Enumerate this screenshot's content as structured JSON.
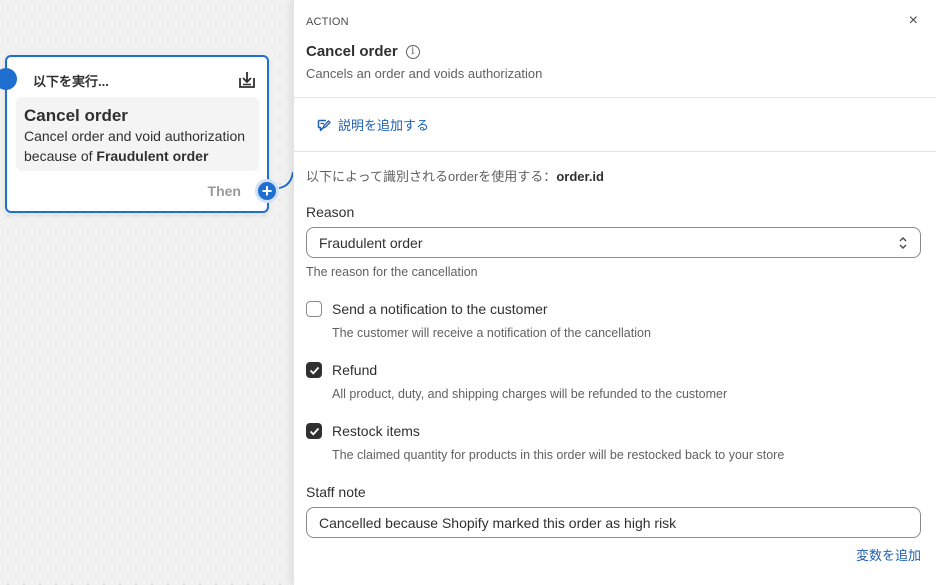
{
  "node": {
    "header_label": "以下を実行...",
    "title": "Cancel order",
    "desc_prefix": "Cancel order and void authorization because of ",
    "desc_reason": "Fraudulent order",
    "then_label": "Then",
    "plus": "+"
  },
  "panel": {
    "kicker": "ACTION",
    "close": "×",
    "title": "Cancel order",
    "info": "i",
    "subtitle": "Cancels an order and voids authorization",
    "add_description": "説明を追加する",
    "using_prefix": "以下によって識別されるorderを使用する：",
    "using_value": "order.id",
    "reason": {
      "label": "Reason",
      "value": "Fraudulent order",
      "help": "The reason for the cancellation"
    },
    "options": [
      {
        "label": "Send a notification to the customer",
        "help": "The customer will receive a notification of the cancellation",
        "checked": false
      },
      {
        "label": "Refund",
        "help": "All product, duty, and shipping charges will be refunded to the customer",
        "checked": true
      },
      {
        "label": "Restock items",
        "help": "The claimed quantity for products in this order will be restocked back to your store",
        "checked": true
      }
    ],
    "staff_note": {
      "label": "Staff note",
      "value": "Cancelled because Shopify marked this order as high risk"
    },
    "add_variable": "変数を追加"
  },
  "colors": {
    "accent": "#1f6fd0",
    "link": "#1f5fb4",
    "checkbox_checked": "#303030"
  }
}
